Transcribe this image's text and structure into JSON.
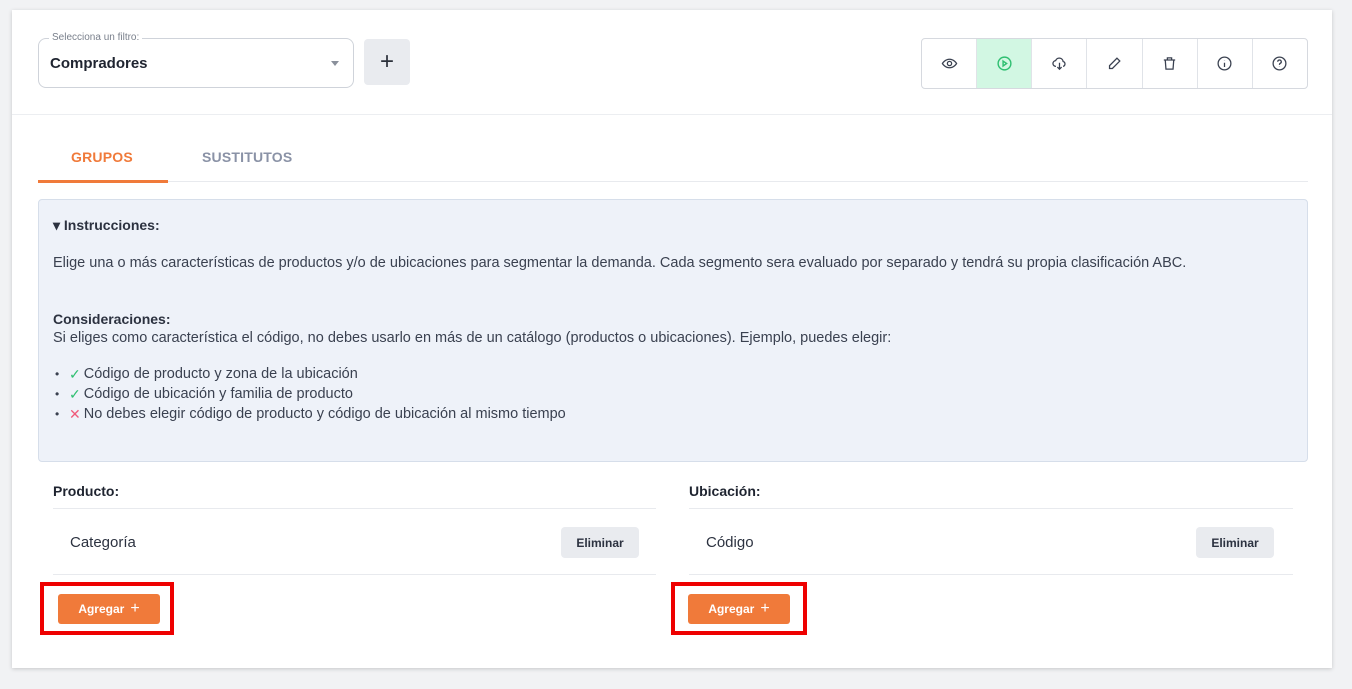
{
  "filter": {
    "label": "Selecciona un filtro:",
    "value": "Compradores"
  },
  "add_filter_symbol": "+",
  "toolbar": {
    "items": [
      {
        "icon": "eye-icon"
      },
      {
        "icon": "play-icon",
        "active": true,
        "color": "#2fbf71"
      },
      {
        "icon": "cloud-download-icon"
      },
      {
        "icon": "pencil-icon"
      },
      {
        "icon": "trash-icon"
      },
      {
        "icon": "info-icon"
      },
      {
        "icon": "help-icon"
      }
    ]
  },
  "tabs": [
    {
      "label": "GRUPOS",
      "active": true
    },
    {
      "label": "SUSTITUTOS",
      "active": false
    }
  ],
  "instructions": {
    "title": "▾ Instrucciones:",
    "description": "Elige una o más características de productos y/o de ubicaciones para segmentar la demanda. Cada segmento sera evaluado por separado y tendrá su propia clasificación ABC.",
    "considerations_title": "Consideraciones:",
    "considerations_text": "Si eliges como característica el código, no debes usarlo en más de un catálogo (productos o ubicaciones). Ejemplo, puedes elegir:",
    "items": [
      {
        "mark": "✓",
        "ok": true,
        "text": "Código de producto y zona de la ubicación"
      },
      {
        "mark": "✓",
        "ok": true,
        "text": "Código de ubicación y familia de producto"
      },
      {
        "mark": "✕",
        "ok": false,
        "text": "No debes elegir código de producto y código de ubicación al mismo tiempo"
      }
    ]
  },
  "product": {
    "title": "Producto:",
    "row_label": "Categoría",
    "delete_label": "Eliminar",
    "add_label": "Agregar",
    "add_symbol": "+"
  },
  "location": {
    "title": "Ubicación:",
    "row_label": "Código",
    "delete_label": "Eliminar",
    "add_label": "Agregar",
    "add_symbol": "+"
  },
  "colors": {
    "accent": "#f07a3a",
    "active_tool_bg": "#d2f7e3",
    "highlight": "#ee0000",
    "instructions_bg": "#eef2f9"
  }
}
